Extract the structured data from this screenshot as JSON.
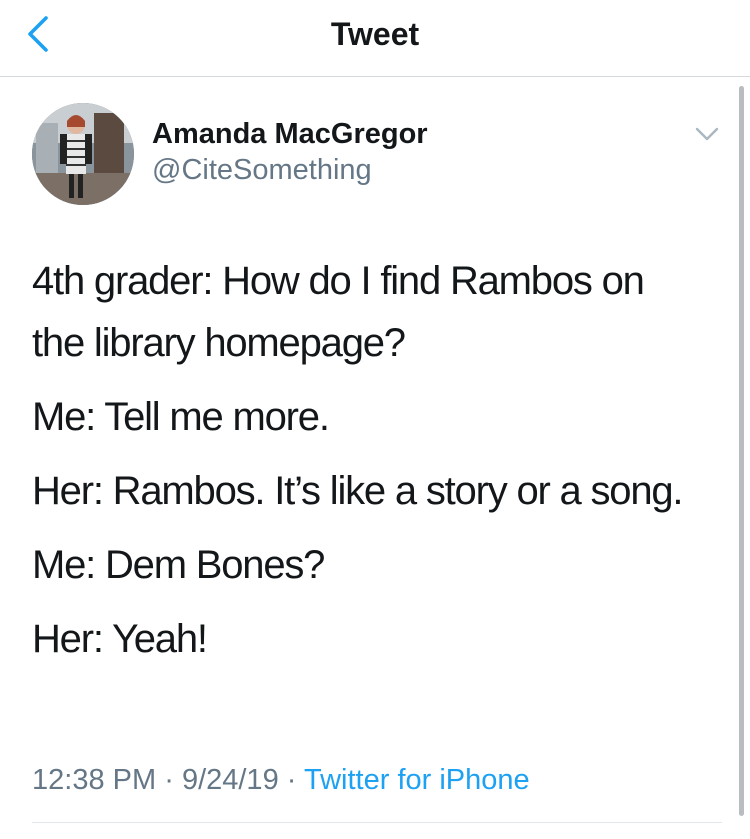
{
  "nav": {
    "title": "Tweet",
    "back_icon": "chevron-left-icon"
  },
  "tweet": {
    "author_name": "Amanda MacGregor",
    "author_handle": "@CiteSomething",
    "avatar_icon": "profile-photo",
    "menu_icon": "chevron-down-icon",
    "paragraphs": [
      [
        "4th grader: How do I find Rambos on",
        "the library homepage?"
      ],
      [
        "Me: Tell me more."
      ],
      [
        "Her: Rambos. It’s like a story or a song."
      ],
      [
        "Me: Dem Bones?"
      ],
      [
        "Her: Yeah!"
      ]
    ],
    "time": "12:38 PM",
    "date": "9/24/19",
    "separator": "·",
    "source": "Twitter for iPhone"
  },
  "colors": {
    "accent": "#1da1f2",
    "text": "#14171a",
    "secondary": "#657786",
    "divider": "#e1e8ed"
  }
}
